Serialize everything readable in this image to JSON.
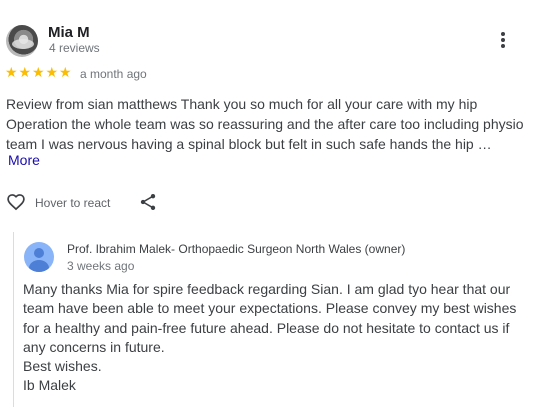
{
  "review": {
    "author_name": "Mia M",
    "author_meta": "4 reviews",
    "rating": 5,
    "stars": [
      "★",
      "★",
      "★",
      "★",
      "★"
    ],
    "date": "a month ago",
    "text_lines": [
      "Review from sian matthews Thank you so much for all your care with my hip",
      "Operation the whole team was so reassuring and the after care too including physio",
      "team I was nervous having a spinal block but felt in such safe hands the hip …"
    ],
    "more_label": "More",
    "react_label": "Hover to react",
    "icons": {
      "menu": "more-vert-icon",
      "like": "heart-outline-icon",
      "share": "share-icon"
    },
    "colors": {
      "star": "#fbbc04",
      "link": "#1a0dab",
      "owner_avatar": "#8ab4f8"
    }
  },
  "owner_reply": {
    "name": "Prof. Ibrahim Malek- Orthopaedic Surgeon North Wales (owner)",
    "date": "3 weeks ago",
    "text_lines": [
      "Many thanks Mia for spire feedback regarding Sian. I am glad tyo hear that our",
      "team have been able to meet your expectations. Please convey my best wishes",
      "for a healthy and pain-free future ahead. Please do not hesitate to contact us if",
      "any concerns in future.",
      "Best wishes.",
      "Ib Malek"
    ]
  }
}
